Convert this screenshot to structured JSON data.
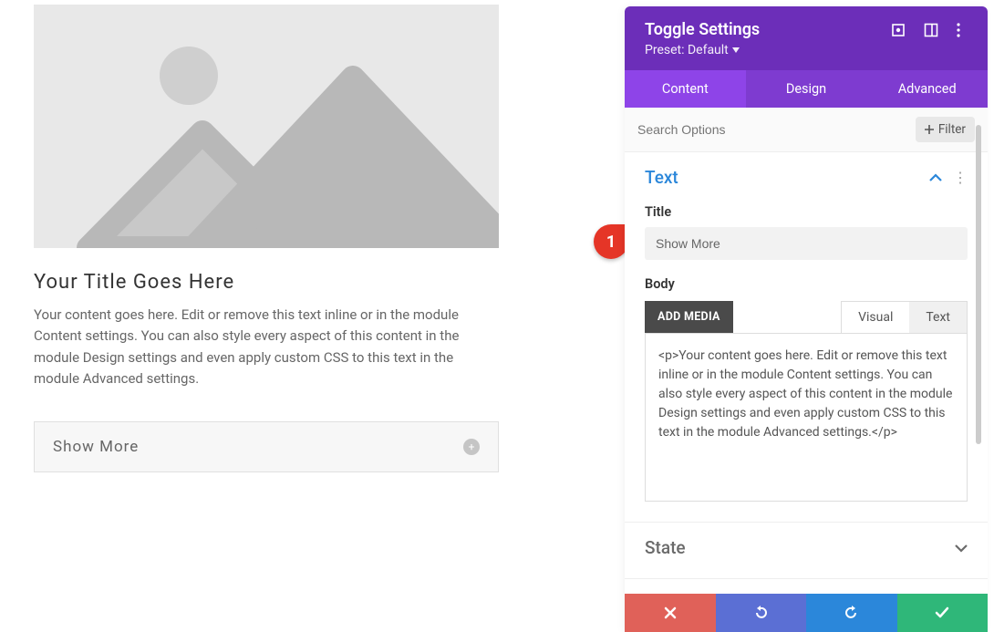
{
  "preview": {
    "title": "Your Title Goes Here",
    "body": "Your content goes here. Edit or remove this text inline or in the module Content settings. You can also style every aspect of this content in the module Design settings and even apply custom CSS to this text in the module Advanced settings.",
    "toggle_label": "Show More"
  },
  "callout": {
    "number": "1"
  },
  "panel": {
    "title": "Toggle Settings",
    "preset": "Preset: Default",
    "tabs": {
      "content": "Content",
      "design": "Design",
      "advanced": "Advanced"
    },
    "search_placeholder": "Search Options",
    "filter_label": "Filter",
    "sections": {
      "text": {
        "title": "Text",
        "title_field_label": "Title",
        "title_value": "Show More",
        "body_field_label": "Body",
        "add_media": "ADD MEDIA",
        "editor_tabs": {
          "visual": "Visual",
          "text": "Text"
        },
        "body_value": "<p>Your content goes here. Edit or remove this text inline or in the module Content settings. You can also style every aspect of this content in the module Design settings and even apply custom CSS to this text in the module Advanced settings.</p>"
      },
      "state": {
        "title": "State"
      }
    }
  }
}
